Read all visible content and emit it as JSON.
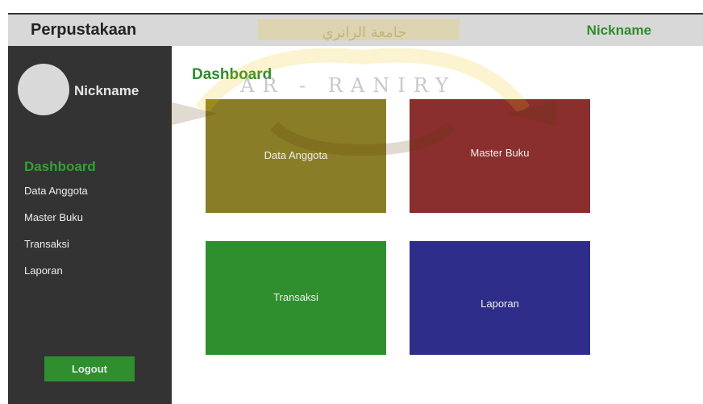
{
  "header": {
    "app_title": "Perpustakaan",
    "nickname": "Nickname"
  },
  "sidebar": {
    "nickname": "Nickname",
    "nav": [
      {
        "label": "Dashboard",
        "active": true
      },
      {
        "label": "Data Anggota"
      },
      {
        "label": "Master Buku"
      },
      {
        "label": "Transaksi"
      },
      {
        "label": "Laporan"
      }
    ],
    "logout_label": "Logout"
  },
  "main": {
    "title": "Dashboard",
    "cards": [
      {
        "label": "Data Anggota",
        "color": "#8a7d27"
      },
      {
        "label": "Master Buku",
        "color": "#8a2e2e"
      },
      {
        "label": "Transaksi",
        "color": "#2f8f2f"
      },
      {
        "label": "Laporan",
        "color": "#2e2e8a"
      }
    ]
  },
  "watermark": {
    "text": "AR - RANIRY",
    "arabic": "جامعة الرانري"
  },
  "colors": {
    "accent_green": "#2e8b2e",
    "sidebar_bg": "#333333",
    "header_bg": "#d8d8d8"
  }
}
